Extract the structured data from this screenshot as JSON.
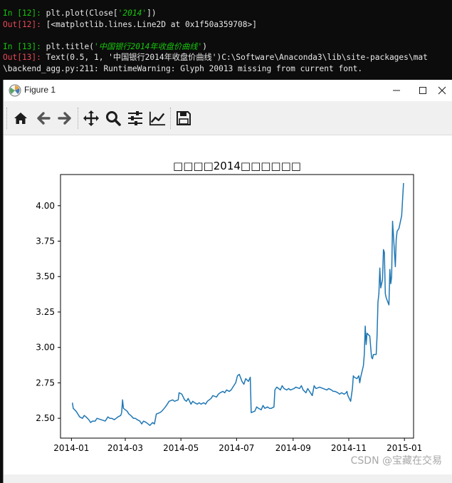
{
  "console": {
    "lines": [
      {
        "prompt": "In [12]: ",
        "kind": "in",
        "pre": "plt.plot(Close[",
        "str": "'2014'",
        "post": "])"
      },
      {
        "prompt": "Out[12]: ",
        "kind": "out",
        "pre": "[<matplotlib.lines.Line2D at 0x1f50a359708>]",
        "str": "",
        "post": ""
      },
      {
        "prompt": "In [13]: ",
        "kind": "in",
        "pre": "plt.title(",
        "str": "'中国银行2014年收盘价曲线'",
        "post": ")"
      },
      {
        "prompt": "Out[13]: ",
        "kind": "out",
        "pre": "Text(0.5, 1, '中国银行2014年收盘价曲线')C:\\Software\\Anaconda3\\lib\\site-packages\\mat",
        "str": "",
        "post": ""
      },
      {
        "prompt": "",
        "kind": "plain",
        "pre": "\\backend_agg.py:211: RuntimeWarning: Glyph 20013 missing from current font.",
        "str": "",
        "post": ""
      }
    ]
  },
  "window": {
    "title": "Figure 1"
  },
  "toolbar": {
    "buttons": [
      "home-icon",
      "back-icon",
      "forward-icon",
      "pan-icon",
      "zoom-icon",
      "configure-subplots-icon",
      "edit-axis-icon",
      "save-icon"
    ]
  },
  "watermark": "CSDN @宝藏在交易",
  "chart_data": {
    "type": "line",
    "title": "□□□□2014□□□□□□",
    "xlabel": "",
    "ylabel": "",
    "x_ticks": [
      "2014-01",
      "2014-03",
      "2014-05",
      "2014-07",
      "2014-09",
      "2014-11",
      "2015-01"
    ],
    "y_ticks": [
      "2.50",
      "2.75",
      "3.00",
      "3.25",
      "3.50",
      "3.75",
      "4.00"
    ],
    "xlim": [
      "2013-12-20",
      "2015-01-11"
    ],
    "ylim": [
      2.36,
      4.22
    ],
    "grid": false,
    "series": [
      {
        "color": "#1f77b4",
        "points": [
          [
            "2014-01-02",
            2.61
          ],
          [
            "2014-01-03",
            2.57
          ],
          [
            "2014-01-06",
            2.55
          ],
          [
            "2014-01-08",
            2.53
          ],
          [
            "2014-01-10",
            2.51
          ],
          [
            "2014-01-13",
            2.5
          ],
          [
            "2014-01-15",
            2.52
          ],
          [
            "2014-01-17",
            2.51
          ],
          [
            "2014-01-20",
            2.49
          ],
          [
            "2014-01-22",
            2.47
          ],
          [
            "2014-01-24",
            2.48
          ],
          [
            "2014-01-27",
            2.48
          ],
          [
            "2014-01-29",
            2.5
          ],
          [
            "2014-02-07",
            2.48
          ],
          [
            "2014-02-10",
            2.51
          ],
          [
            "2014-02-12",
            2.5
          ],
          [
            "2014-02-14",
            2.5
          ],
          [
            "2014-02-17",
            2.49
          ],
          [
            "2014-02-19",
            2.5
          ],
          [
            "2014-02-21",
            2.51
          ],
          [
            "2014-02-24",
            2.52
          ],
          [
            "2014-02-25",
            2.54
          ],
          [
            "2014-02-26",
            2.63
          ],
          [
            "2014-02-27",
            2.57
          ],
          [
            "2014-03-03",
            2.55
          ],
          [
            "2014-03-05",
            2.53
          ],
          [
            "2014-03-07",
            2.52
          ],
          [
            "2014-03-10",
            2.5
          ],
          [
            "2014-03-12",
            2.5
          ],
          [
            "2014-03-14",
            2.49
          ],
          [
            "2014-03-17",
            2.48
          ],
          [
            "2014-03-19",
            2.46
          ],
          [
            "2014-03-21",
            2.48
          ],
          [
            "2014-03-24",
            2.47
          ],
          [
            "2014-03-26",
            2.46
          ],
          [
            "2014-03-28",
            2.45
          ],
          [
            "2014-03-31",
            2.47
          ],
          [
            "2014-04-02",
            2.46
          ],
          [
            "2014-04-04",
            2.53
          ],
          [
            "2014-04-08",
            2.54
          ],
          [
            "2014-04-10",
            2.55
          ],
          [
            "2014-04-14",
            2.58
          ],
          [
            "2014-04-16",
            2.6
          ],
          [
            "2014-04-18",
            2.62
          ],
          [
            "2014-04-22",
            2.63
          ],
          [
            "2014-04-24",
            2.62
          ],
          [
            "2014-04-28",
            2.63
          ],
          [
            "2014-04-29",
            2.68
          ],
          [
            "2014-05-02",
            2.67
          ],
          [
            "2014-05-05",
            2.63
          ],
          [
            "2014-05-07",
            2.62
          ],
          [
            "2014-05-09",
            2.64
          ],
          [
            "2014-05-12",
            2.6
          ],
          [
            "2014-05-14",
            2.62
          ],
          [
            "2014-05-16",
            2.61
          ],
          [
            "2014-05-19",
            2.6
          ],
          [
            "2014-05-21",
            2.61
          ],
          [
            "2014-05-23",
            2.6
          ],
          [
            "2014-05-26",
            2.61
          ],
          [
            "2014-05-28",
            2.6
          ],
          [
            "2014-05-30",
            2.62
          ],
          [
            "2014-06-03",
            2.64
          ],
          [
            "2014-06-05",
            2.66
          ],
          [
            "2014-06-09",
            2.65
          ],
          [
            "2014-06-11",
            2.67
          ],
          [
            "2014-06-13",
            2.68
          ],
          [
            "2014-06-16",
            2.69
          ],
          [
            "2014-06-18",
            2.68
          ],
          [
            "2014-06-20",
            2.7
          ],
          [
            "2014-06-23",
            2.69
          ],
          [
            "2014-06-25",
            2.7
          ],
          [
            "2014-06-27",
            2.72
          ],
          [
            "2014-06-30",
            2.75
          ],
          [
            "2014-07-02",
            2.8
          ],
          [
            "2014-07-04",
            2.81
          ],
          [
            "2014-07-07",
            2.76
          ],
          [
            "2014-07-09",
            2.74
          ],
          [
            "2014-07-11",
            2.78
          ],
          [
            "2014-07-14",
            2.76
          ],
          [
            "2014-07-16",
            2.79
          ],
          [
            "2014-07-17",
            2.54
          ],
          [
            "2014-07-21",
            2.55
          ],
          [
            "2014-07-23",
            2.58
          ],
          [
            "2014-07-25",
            2.57
          ],
          [
            "2014-07-28",
            2.56
          ],
          [
            "2014-07-30",
            2.59
          ],
          [
            "2014-08-01",
            2.57
          ],
          [
            "2014-08-04",
            2.58
          ],
          [
            "2014-08-06",
            2.57
          ],
          [
            "2014-08-08",
            2.57
          ],
          [
            "2014-08-11",
            2.58
          ],
          [
            "2014-08-12",
            2.7
          ],
          [
            "2014-08-14",
            2.72
          ],
          [
            "2014-08-18",
            2.7
          ],
          [
            "2014-08-20",
            2.73
          ],
          [
            "2014-08-22",
            2.71
          ],
          [
            "2014-08-25",
            2.7
          ],
          [
            "2014-08-27",
            2.71
          ],
          [
            "2014-08-29",
            2.7
          ],
          [
            "2014-09-02",
            2.71
          ],
          [
            "2014-09-04",
            2.72
          ],
          [
            "2014-09-08",
            2.71
          ],
          [
            "2014-09-10",
            2.73
          ],
          [
            "2014-09-12",
            2.7
          ],
          [
            "2014-09-15",
            2.68
          ],
          [
            "2014-09-17",
            2.71
          ],
          [
            "2014-09-19",
            2.69
          ],
          [
            "2014-09-22",
            2.66
          ],
          [
            "2014-09-24",
            2.73
          ],
          [
            "2014-09-26",
            2.71
          ],
          [
            "2014-09-30",
            2.72
          ],
          [
            "2014-10-08",
            2.7
          ],
          [
            "2014-10-10",
            2.71
          ],
          [
            "2014-10-13",
            2.7
          ],
          [
            "2014-10-15",
            2.69
          ],
          [
            "2014-10-17",
            2.69
          ],
          [
            "2014-10-20",
            2.68
          ],
          [
            "2014-10-22",
            2.67
          ],
          [
            "2014-10-24",
            2.68
          ],
          [
            "2014-10-27",
            2.67
          ],
          [
            "2014-10-29",
            2.68
          ],
          [
            "2014-10-30",
            2.69
          ],
          [
            "2014-10-31",
            2.66
          ],
          [
            "2014-11-03",
            2.62
          ],
          [
            "2014-11-05",
            2.71
          ],
          [
            "2014-11-06",
            2.8
          ],
          [
            "2014-11-07",
            2.79
          ],
          [
            "2014-11-10",
            2.78
          ],
          [
            "2014-11-12",
            2.8
          ],
          [
            "2014-11-13",
            2.75
          ],
          [
            "2014-11-14",
            2.79
          ],
          [
            "2014-11-17",
            2.87
          ],
          [
            "2014-11-18",
            2.95
          ],
          [
            "2014-11-19",
            3.15
          ],
          [
            "2014-11-20",
            3.02
          ],
          [
            "2014-11-21",
            3.1
          ],
          [
            "2014-11-24",
            3.08
          ],
          [
            "2014-11-25",
            3.0
          ],
          [
            "2014-11-26",
            2.93
          ],
          [
            "2014-11-27",
            2.92
          ],
          [
            "2014-11-28",
            2.95
          ],
          [
            "2014-12-01",
            2.95
          ],
          [
            "2014-12-02",
            3.08
          ],
          [
            "2014-12-03",
            3.32
          ],
          [
            "2014-12-04",
            3.38
          ],
          [
            "2014-12-05",
            3.56
          ],
          [
            "2014-12-06",
            3.42
          ],
          [
            "2014-12-08",
            3.48
          ],
          [
            "2014-12-09",
            3.69
          ],
          [
            "2014-12-10",
            3.67
          ],
          [
            "2014-12-11",
            3.38
          ],
          [
            "2014-12-12",
            3.35
          ],
          [
            "2014-12-15",
            3.3
          ],
          [
            "2014-12-16",
            3.55
          ],
          [
            "2014-12-17",
            3.45
          ],
          [
            "2014-12-18",
            3.5
          ],
          [
            "2014-12-19",
            3.89
          ],
          [
            "2014-12-22",
            3.57
          ],
          [
            "2014-12-23",
            3.76
          ],
          [
            "2014-12-24",
            3.82
          ],
          [
            "2014-12-25",
            3.83
          ],
          [
            "2014-12-26",
            3.84
          ],
          [
            "2014-12-29",
            3.93
          ],
          [
            "2014-12-31",
            4.16
          ]
        ]
      }
    ]
  }
}
